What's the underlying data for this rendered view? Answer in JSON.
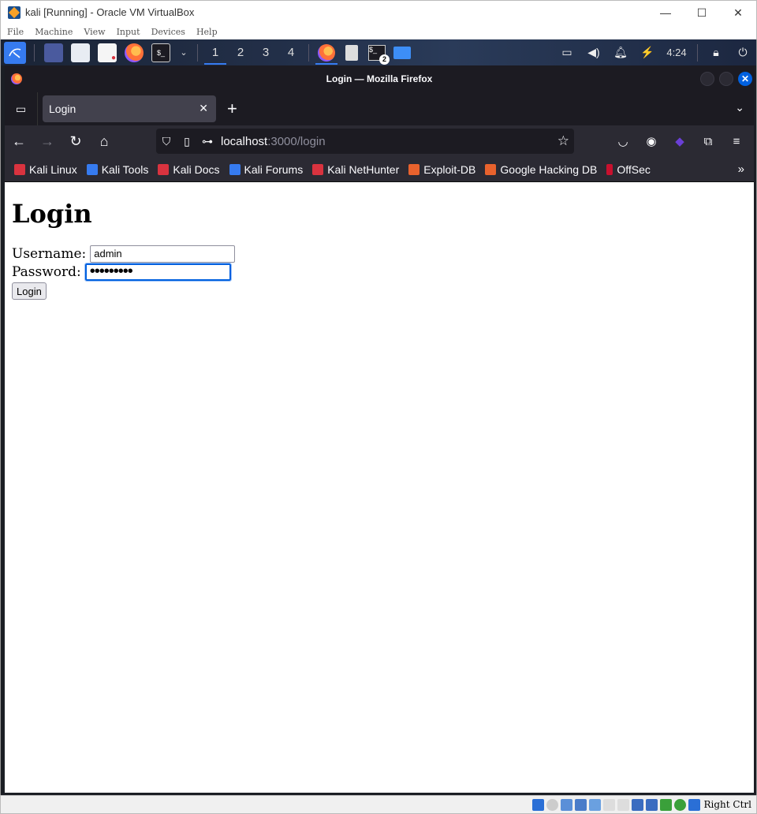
{
  "host": {
    "title": "kali [Running] - Oracle VM VirtualBox",
    "window_controls": {
      "minimize": "—",
      "maximize": "☐",
      "close": "✕"
    },
    "menu": [
      "File",
      "Machine",
      "View",
      "Input",
      "Devices",
      "Help"
    ],
    "status_right_label": "Right Ctrl"
  },
  "panel": {
    "workspaces": [
      "1",
      "2",
      "3",
      "4"
    ],
    "active_workspace": "1",
    "terminal_badge": "2",
    "clock": "4:24"
  },
  "firefox": {
    "window_title": "Login — Mozilla Firefox",
    "tab_label": "Login",
    "url_host": "localhost",
    "url_rest": ":3000/login",
    "bookmarks": [
      {
        "label": "Kali Linux",
        "color": "#d9333f"
      },
      {
        "label": "Kali Tools",
        "color": "#367bf0"
      },
      {
        "label": "Kali Docs",
        "color": "#d9333f"
      },
      {
        "label": "Kali Forums",
        "color": "#367bf0"
      },
      {
        "label": "Kali NetHunter",
        "color": "#d9333f"
      },
      {
        "label": "Exploit-DB",
        "color": "#e8622d"
      },
      {
        "label": "Google Hacking DB",
        "color": "#e8622d"
      },
      {
        "label": "OffSec",
        "color": "#c8102e"
      }
    ]
  },
  "page": {
    "heading": "Login",
    "username_label": "Username:",
    "username_value": "admin",
    "password_label": "Password:",
    "password_value": "adminpass",
    "submit_label": "Login"
  },
  "colors": {
    "accent": "#0060df",
    "kali_blue": "#367bf0",
    "firefox_dark": "#1c1b22"
  }
}
